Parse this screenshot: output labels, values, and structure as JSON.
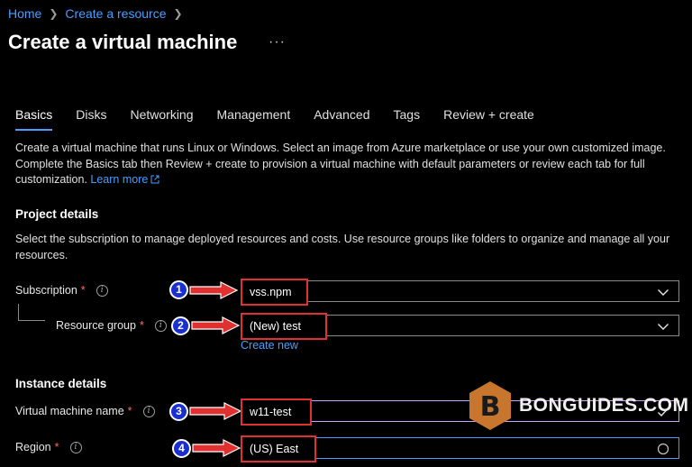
{
  "breadcrumb": [
    "Home",
    "Create a resource"
  ],
  "page": {
    "title": "Create a virtual machine",
    "more": "···"
  },
  "tabs": [
    "Basics",
    "Disks",
    "Networking",
    "Management",
    "Advanced",
    "Tags",
    "Review + create"
  ],
  "intro": {
    "text": "Create a virtual machine that runs Linux or Windows. Select an image from Azure marketplace or use your own customized image. Complete the Basics tab then Review + create to provision a virtual machine with default parameters or review each tab for full customization.",
    "link": "Learn more"
  },
  "project": {
    "title": "Project details",
    "desc": "Select the subscription to manage deployed resources and costs. Use resource groups like folders to organize and manage all your resources.",
    "subscription": {
      "label": "Subscription",
      "value": "vss.npm"
    },
    "resource_group": {
      "label": "Resource group",
      "value": "(New) test",
      "create_new": "Create new"
    }
  },
  "instance": {
    "title": "Instance details",
    "vm_name": {
      "label": "Virtual machine name",
      "value": "w11-test"
    },
    "region": {
      "label": "Region",
      "value": "(US) East US"
    }
  },
  "markers": [
    "1",
    "2",
    "3",
    "4"
  ],
  "required_mark": "*",
  "info_glyph": "i",
  "watermark": {
    "text": "BONGUIDES.COM",
    "logo_letter": "B"
  },
  "colors": {
    "accent": "#4a9eff",
    "highlight": "#e03030",
    "marker": "#1a2fd0",
    "required": "#ff6b6b",
    "logo": "#c8762e"
  }
}
